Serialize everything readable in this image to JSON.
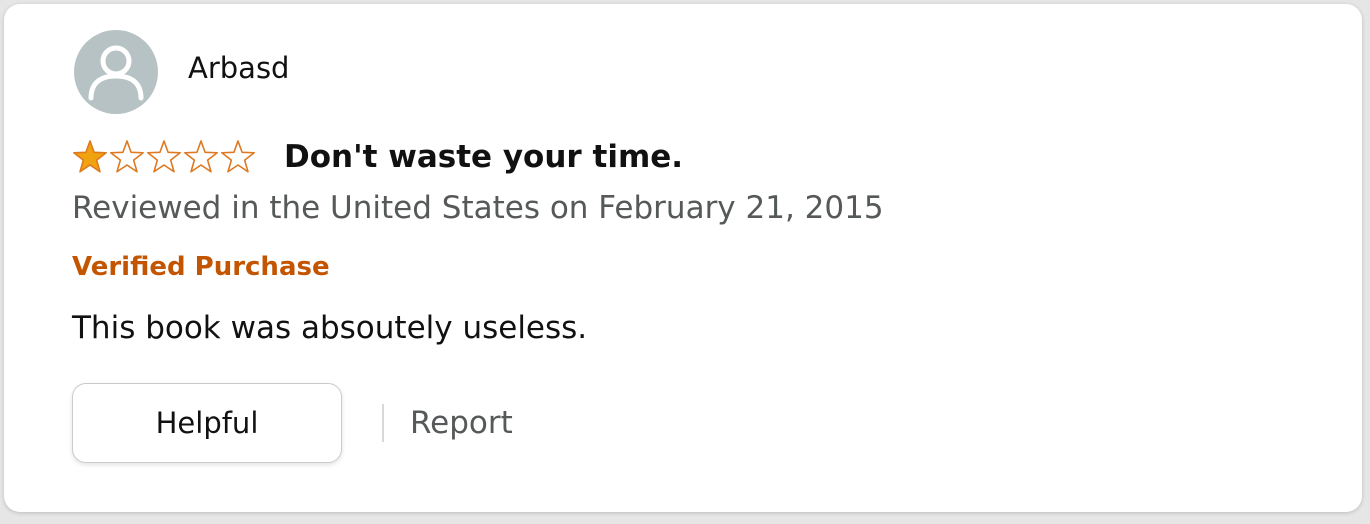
{
  "review": {
    "reviewer_name": "Arbasd",
    "avatar_icon": "user-silhouette-icon",
    "rating": 1,
    "rating_max": 5,
    "title": "Don't waste your time.",
    "meta": "Reviewed in the United States on February 21, 2015",
    "verified_label": "Verified Purchase",
    "body": "This book was absoutely useless.",
    "helpful_label": "Helpful",
    "report_label": "Report"
  },
  "colors": {
    "star_filled": "#f0a30e",
    "star_outline": "#de7921",
    "verified": "#c45500",
    "meta_text": "#565959",
    "avatar_bg": "#b6c2c4"
  }
}
